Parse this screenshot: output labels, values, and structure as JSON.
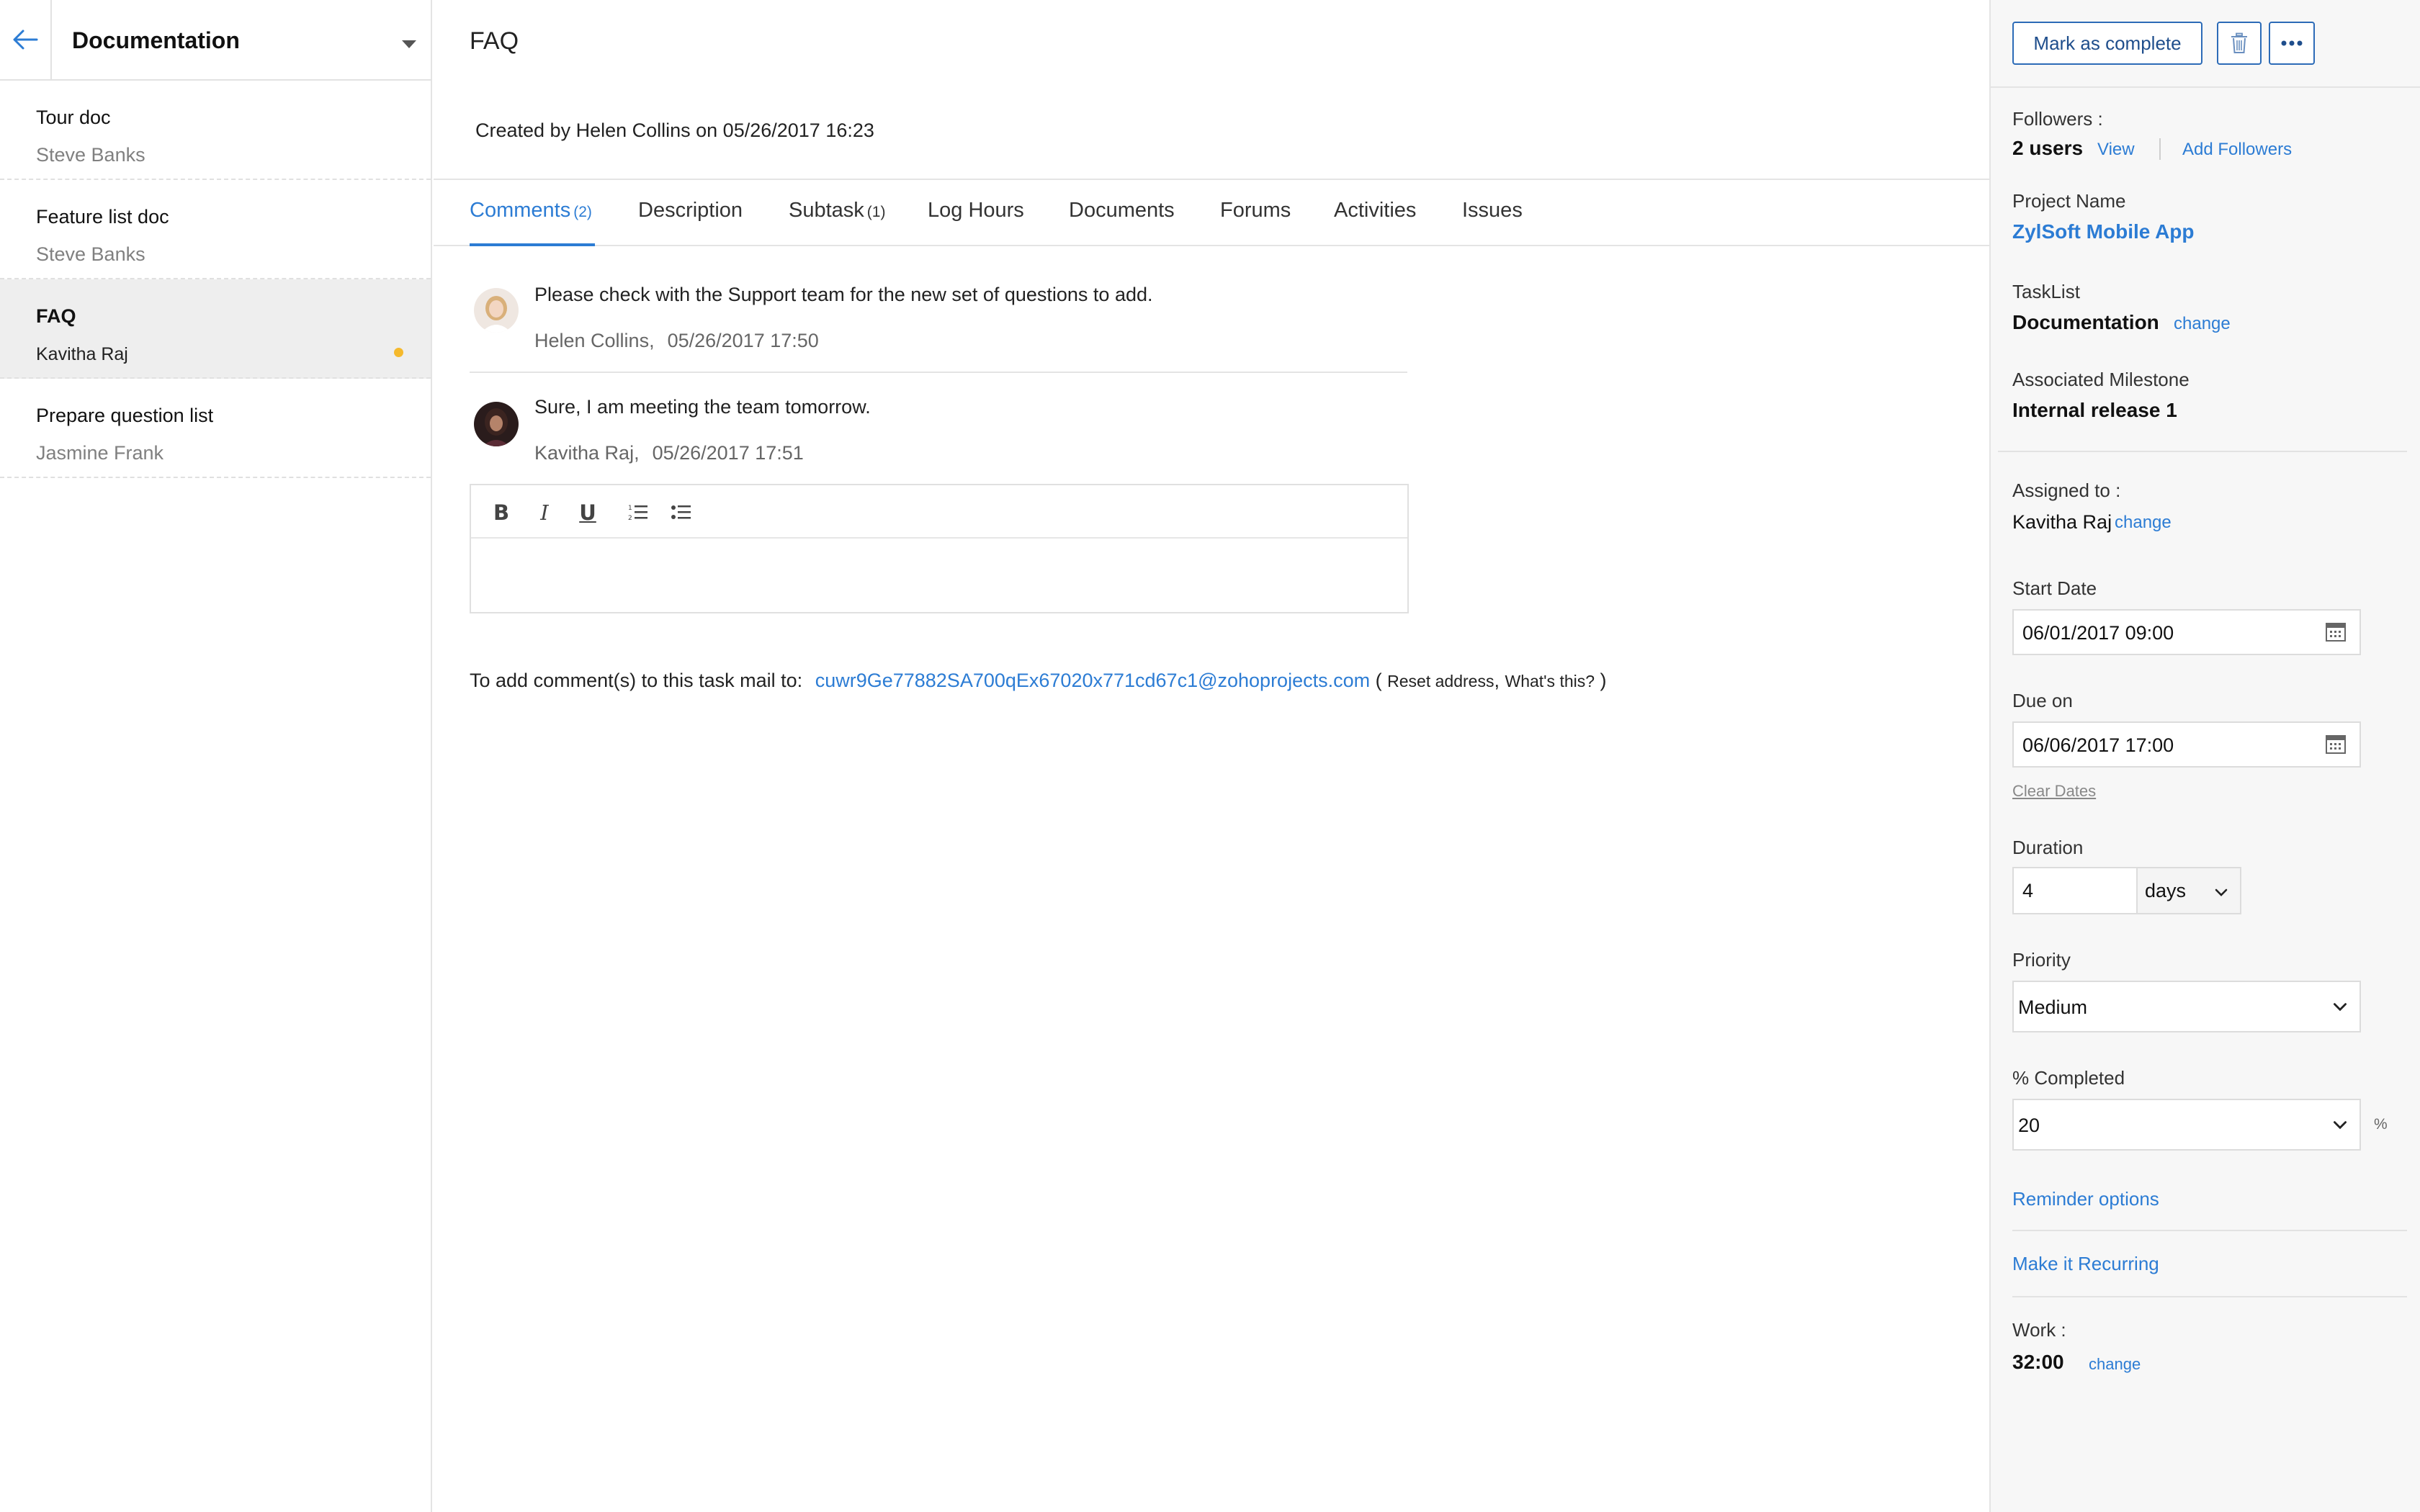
{
  "sidebar": {
    "title": "Documentation",
    "tasks": [
      {
        "name": "Tour doc",
        "owner": "Steve Banks"
      },
      {
        "name": "Feature list doc",
        "owner": "Steve Banks"
      },
      {
        "name": "FAQ",
        "owner": "Kavitha Raj"
      },
      {
        "name": "Prepare question list",
        "owner": "Jasmine Frank"
      }
    ],
    "active_index": 2,
    "status_color": "#f5b92c"
  },
  "main": {
    "title": "FAQ",
    "created_line": "Created by Helen Collins on 05/26/2017 16:23",
    "tabs": [
      {
        "label": "Comments",
        "count": "(2)"
      },
      {
        "label": "Description"
      },
      {
        "label": "Subtask",
        "count": "(1)"
      },
      {
        "label": "Log Hours"
      },
      {
        "label": "Documents"
      },
      {
        "label": "Forums"
      },
      {
        "label": "Activities"
      },
      {
        "label": "Issues"
      }
    ],
    "comments": [
      {
        "text": "Please check with the Support team for the new set of questions to add.",
        "author": "Helen Collins,",
        "date": "05/26/2017 17:50"
      },
      {
        "text": "Sure, I am meeting the team tomorrow.",
        "author": "Kavitha Raj,",
        "date": "05/26/2017 17:51"
      }
    ],
    "editor_tools": [
      "B",
      "I",
      "U",
      "numbered-list-icon",
      "bullet-list-icon"
    ],
    "mail": {
      "prefix": "To add comment(s) to this task mail to:",
      "address": "cuwr9Ge77882SA700qEx67020x771cd67c1@zohoprojects.com",
      "open": "(",
      "reset": "Reset address",
      "comma": ",",
      "whats": "What's this?",
      "close": ")"
    }
  },
  "right": {
    "mark_complete": "Mark as complete",
    "followers_label": "Followers :",
    "followers_count": "2 users",
    "view": "View",
    "add_followers": "Add Followers",
    "project_label": "Project Name",
    "project_name": "ZylSoft Mobile App",
    "tasklist_label": "TaskList",
    "tasklist_value": "Documentation",
    "change": "change",
    "milestone_label": "Associated Milestone",
    "milestone_value": "Internal release 1",
    "assigned_label": "Assigned to :",
    "assigned_value": "Kavitha Raj",
    "start_label": "Start Date",
    "start_value": "06/01/2017 09:00",
    "due_label": "Due on",
    "due_value": "06/06/2017 17:00",
    "clear_dates": "Clear Dates",
    "duration_label": "Duration",
    "duration_value": "4",
    "duration_unit": "days",
    "priority_label": "Priority",
    "priority_value": "Medium",
    "completed_label": "% Completed",
    "completed_value": "20",
    "percent_sign": "%",
    "reminder": "Reminder options",
    "recurring": "Make it Recurring",
    "work_label": "Work :",
    "work_value": "32:00"
  },
  "colors": {
    "accent": "#2c7cd4",
    "button_border": "#2c6bb7"
  }
}
